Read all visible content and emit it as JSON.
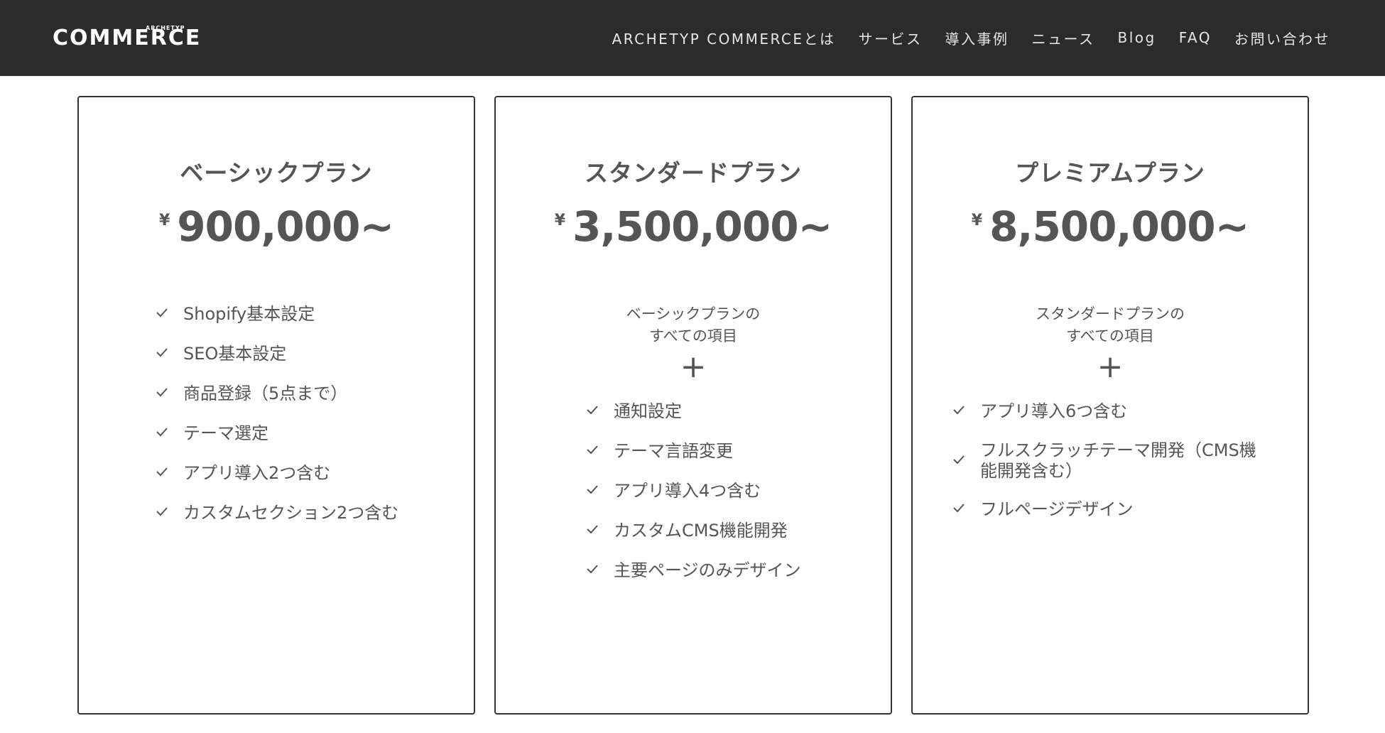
{
  "header": {
    "logo_main": "COMMERCE",
    "logo_small": "ARCHETYP",
    "nav": [
      "ARCHETYP COMMERCEとは",
      "サービス",
      "導入事例",
      "ニュース",
      "Blog",
      "FAQ",
      "お問い合わせ"
    ]
  },
  "plans": [
    {
      "name": "ベーシックプラン",
      "currency": "¥",
      "price": "900,000~",
      "features": [
        "Shopify基本設定",
        "SEO基本設定",
        "商品登録（5点まで）",
        "テーマ選定",
        "アプリ導入2つ含む",
        "カスタムセクション2つ含む"
      ]
    },
    {
      "name": "スタンダードプラン",
      "currency": "¥",
      "price": "3,500,000~",
      "note_line1": "ベーシックプランの",
      "note_line2": "すべての項目",
      "plus": "+",
      "features": [
        "通知設定",
        "テーマ言語変更",
        "アプリ導入4つ含む",
        "カスタムCMS機能開発",
        "主要ページのみデザイン"
      ]
    },
    {
      "name": "プレミアムプラン",
      "currency": "¥",
      "price": "8,500,000~",
      "note_line1": "スタンダードプランの",
      "note_line2": "すべての項目",
      "plus": "+",
      "features": [
        "アプリ導入6つ含む",
        "フルスクラッチテーマ開発（CMS機能開発含む）",
        "フルページデザイン"
      ]
    }
  ],
  "icons": {
    "check": "check-icon"
  }
}
